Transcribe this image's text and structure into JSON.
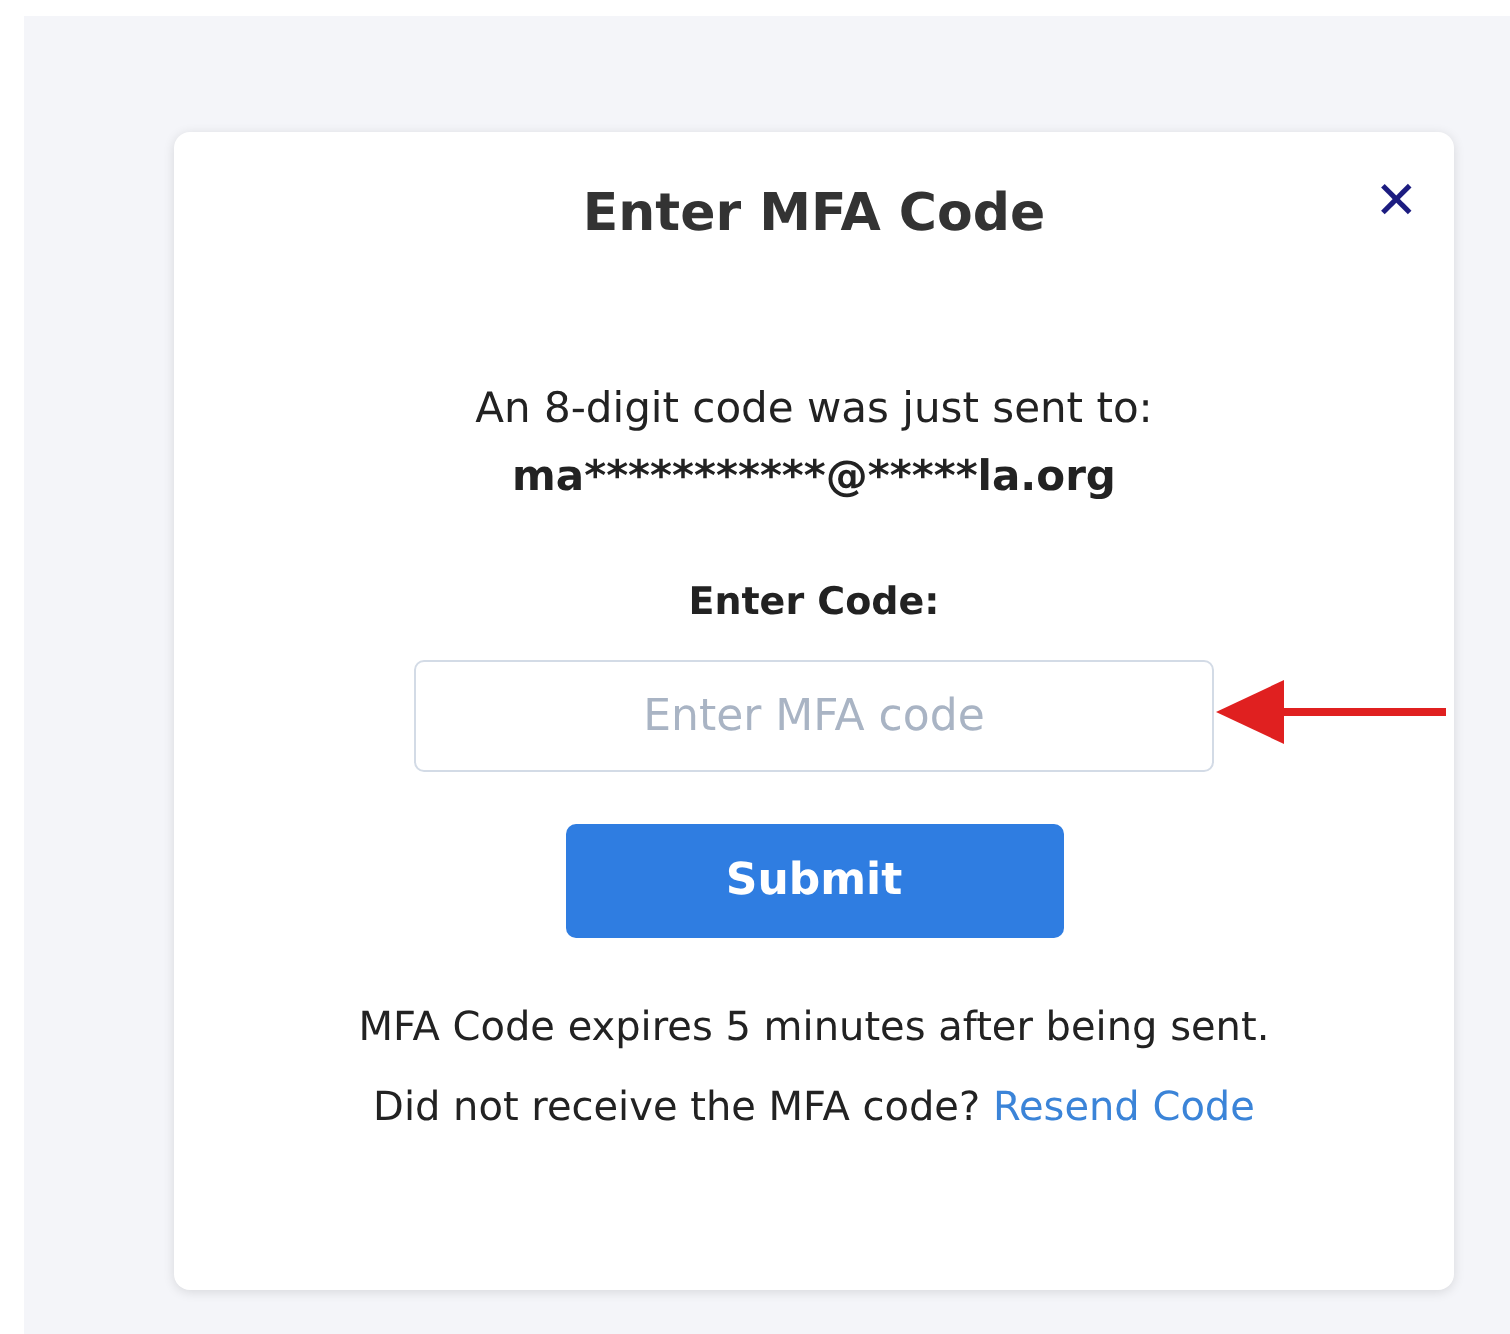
{
  "dialog": {
    "title": "Enter MFA Code",
    "close_icon": "✕",
    "message": "An 8-digit code was just sent to:",
    "email": "ma***********@*****la.org",
    "field_label": "Enter Code:",
    "code_field": {
      "placeholder": "Enter MFA code"
    },
    "submit_button": "Submit",
    "expiry_note": "MFA Code expires 5 minutes after being sent.",
    "resend_prompt": "Did not receive the MFA code?",
    "resend_link": "Resend Code"
  }
}
